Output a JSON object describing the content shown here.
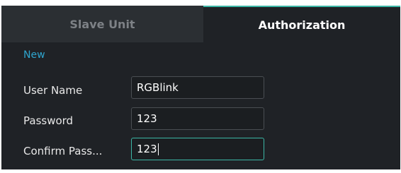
{
  "tabs": {
    "slave_unit": "Slave Unit",
    "authorization": "Authorization",
    "active": "Authorization"
  },
  "form": {
    "section_title": "New",
    "user_name": {
      "label": "User Name",
      "value": "RGBlink"
    },
    "password": {
      "label": "Password",
      "value": "123"
    },
    "confirm_password": {
      "label": "Confirm Pass...",
      "value": "123"
    }
  },
  "colors": {
    "panel_bg": "#1f2226",
    "inactive_tab_bg": "#2b2f33",
    "accent": "#3cb7a6",
    "section_title": "#2fa6cf"
  }
}
